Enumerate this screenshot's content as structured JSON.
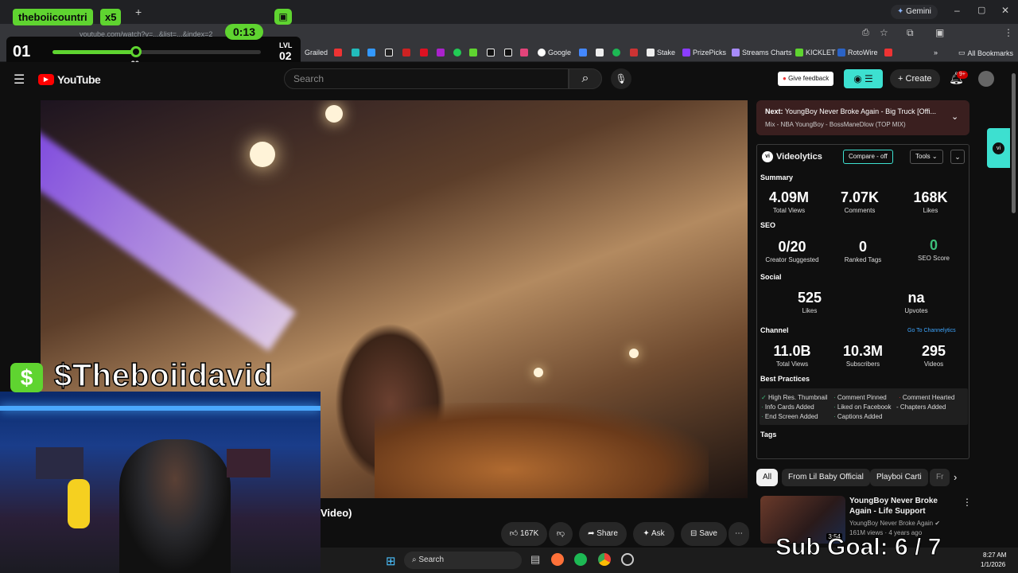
{
  "browser": {
    "tab_title": "theboiicountri",
    "gemini_label": "Gemini",
    "address": "youtube.com/watch?v=...&list=...&index=2",
    "all_bookmarks": "All Bookmarks",
    "bookmarks": [
      "Grailed",
      "Google",
      "Stake",
      "PrizePicks",
      "Streams Charts",
      "KICKLET",
      "RotoWire"
    ]
  },
  "overlay": {
    "name_chip": "theboiicountri",
    "multiplier": "x5",
    "timer": "0:13",
    "level_left": "01",
    "level_marker": "26",
    "level_right_top": "LVL",
    "level_right": "02",
    "progress": 0.4,
    "dollar_sign": "$",
    "streamer_tag": "$Theboiidavid",
    "sub_goal": "Sub Goal:  6 / 7"
  },
  "youtube": {
    "logo": "YouTube",
    "search_placeholder": "Search",
    "give_feedback": "Give feedback",
    "create": "Create",
    "notif_badge": "9+",
    "next_label": "Next:",
    "next_title": "YoungBoy Never Broke Again - Big Truck [Offi...",
    "next_sub": "Mix - NBA YoungBoy - BossManeDlow (TOP MIX)",
    "video_title_tail": "Video)",
    "likes": "167K",
    "share": "Share",
    "ask": "Ask",
    "save": "Save",
    "chips": [
      "All",
      "From Lil Baby Official",
      "Playboi Carti",
      "Fr"
    ],
    "rec": {
      "title": "YoungBoy Never Broke Again - Life Support [Official Music ...",
      "channel": "YoungBoy Never Broke Again",
      "meta": "161M views · 4 years ago",
      "duration": "3:54"
    }
  },
  "videolytics": {
    "brand": "Videolytics",
    "compare": "Compare - off",
    "tools": "Tools",
    "summary_label": "Summary",
    "summary": [
      {
        "value": "4.09M",
        "label": "Total Views"
      },
      {
        "value": "7.07K",
        "label": "Comments"
      },
      {
        "value": "168K",
        "label": "Likes"
      }
    ],
    "seo_label": "SEO",
    "seo": [
      {
        "value": "0/20",
        "label": "Creator Suggested"
      },
      {
        "value": "0",
        "label": "Ranked Tags"
      },
      {
        "value": "0",
        "label": "SEO Score"
      }
    ],
    "social_label": "Social",
    "social": [
      {
        "value": "525",
        "label": "Likes"
      },
      {
        "value": "na",
        "label": "Upvotes"
      }
    ],
    "channel_label": "Channel",
    "channel_link": "Go To Channelytics",
    "channel": [
      {
        "value": "11.0B",
        "label": "Total Views"
      },
      {
        "value": "10.3M",
        "label": "Subscribers"
      },
      {
        "value": "295",
        "label": "Videos"
      }
    ],
    "bp_label": "Best Practices",
    "best_practices": [
      "High Res. Thumbnail",
      "Comment Pinned",
      "Comment Hearted",
      "Info Cards Added",
      "Liked on Facebook",
      "Chapters Added",
      "End Screen Added",
      "Captions Added"
    ],
    "tags_label": "Tags"
  },
  "taskbar": {
    "search": "Search",
    "time": "8:27 AM",
    "date": "1/1/2026"
  },
  "colors": {
    "accent_green": "#5fd430",
    "yt_red": "#ff0000",
    "teal": "#3de0d0"
  }
}
